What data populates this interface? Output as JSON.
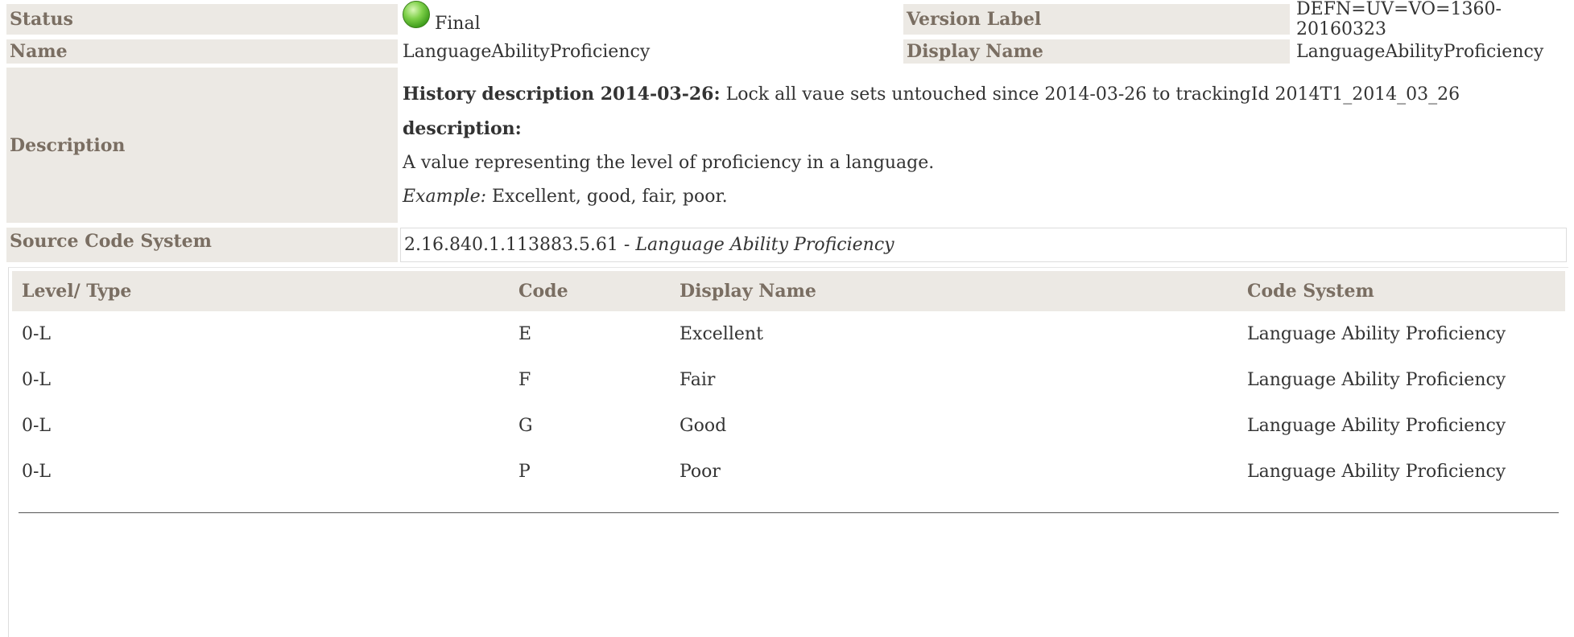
{
  "meta": {
    "status_label": "Status",
    "status_value": "Final",
    "version_label_label": "Version Label",
    "version_label_value": "DEFN=UV=VO=1360-20160323",
    "name_label": "Name",
    "name_value": "LanguageAbilityProficiency",
    "display_name_label": "Display Name",
    "display_name_value": "LanguageAbilityProficiency",
    "description_label": "Description",
    "source_code_system_label": "Source Code System"
  },
  "description": {
    "history_heading": "History description 2014-03-26:",
    "history_text": " Lock all vaue sets untouched since 2014-03-26 to trackingId 2014T1_2014_03_26",
    "desc_heading": "description:",
    "desc_text": "A value representing the level of proficiency in a language.",
    "example_label": "Example:",
    "example_text": " Excellent, good, fair, poor."
  },
  "source_code_system": {
    "oid": "2.16.840.1.113883.5.61",
    "separator": " - ",
    "name": "Language Ability Proficiency"
  },
  "table": {
    "headers": [
      "Level/ Type",
      "Code",
      "Display Name",
      "Code System"
    ],
    "rows": [
      [
        "0-L",
        "E",
        "Excellent",
        "Language Ability Proficiency"
      ],
      [
        "0-L",
        "F",
        "Fair",
        "Language Ability Proficiency"
      ],
      [
        "0-L",
        "G",
        "Good",
        "Language Ability Proficiency"
      ],
      [
        "0-L",
        "P",
        "Poor",
        "Language Ability Proficiency"
      ]
    ]
  },
  "colors": {
    "label_bg": "#ece9e4",
    "label_text": "#7a6e62",
    "status_final": "#4cae21"
  },
  "icons": {
    "status": "green-status-orb-icon"
  }
}
